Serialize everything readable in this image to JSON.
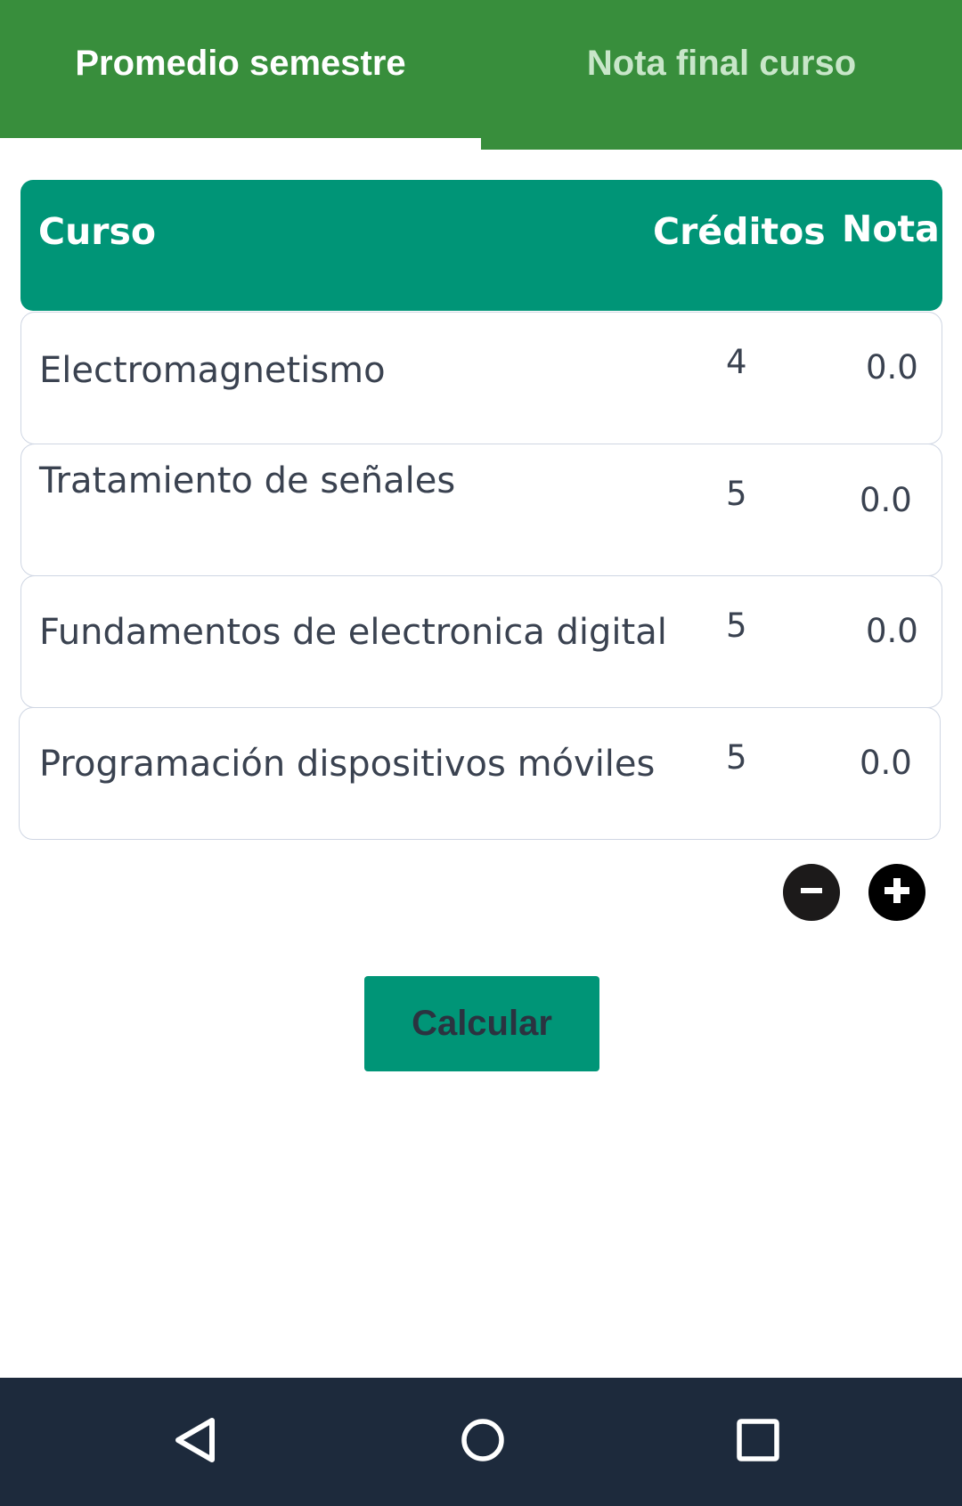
{
  "tabs": {
    "left_label": "Promedio semestre",
    "right_label": "Nota final curso"
  },
  "table": {
    "header": {
      "course": "Curso",
      "credits": "Créditos",
      "grade": "Nota"
    },
    "rows": [
      {
        "course": "Electromagnetismo",
        "credits": "4",
        "grade": "0.0"
      },
      {
        "course": "Tratamiento de señales",
        "credits": "5",
        "grade": "0.0"
      },
      {
        "course": "Fundamentos de electronica digital",
        "credits": "5",
        "grade": "0.0"
      },
      {
        "course": "Programación dispositivos móviles",
        "credits": "5",
        "grade": "0.0"
      }
    ]
  },
  "controls": {
    "remove_icon": "minus-circle-icon",
    "add_icon": "plus-circle-icon",
    "calculate_label": "Calcular"
  },
  "navbar": {
    "back_icon": "back-triangle-icon",
    "home_icon": "home-circle-icon",
    "recents_icon": "recents-square-icon"
  },
  "colors": {
    "tab_bar": "#388e3c",
    "accent": "#009577",
    "navbar": "#1d2a3c"
  }
}
